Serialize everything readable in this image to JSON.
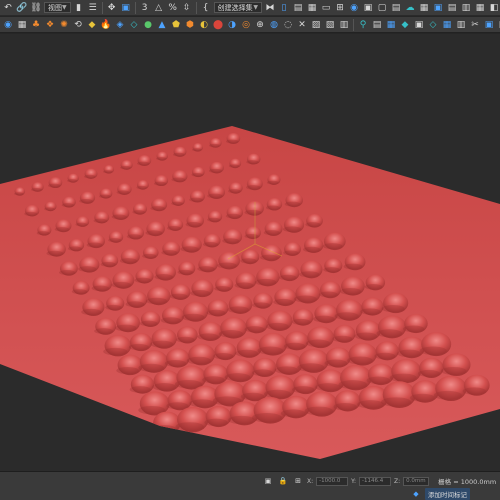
{
  "toolbar_top": {
    "view_dropdown": "视图",
    "selection_set_dropdown": "创建选择集",
    "snap_number": "3",
    "angle_snap_label": "△",
    "percent_snap_label": "%"
  },
  "statusbar": {
    "x_label": "X:",
    "x_value": "-1000.0",
    "y_label": "Y:",
    "y_value": "-1146.4",
    "z_label": "Z:",
    "z_value": "0.0mm",
    "grid_label": "栅格 = 1000.0mm",
    "add_time_tag": "添加时间标记"
  },
  "colors": {
    "surface": "#d4504f",
    "background": "#2b2b2b"
  }
}
